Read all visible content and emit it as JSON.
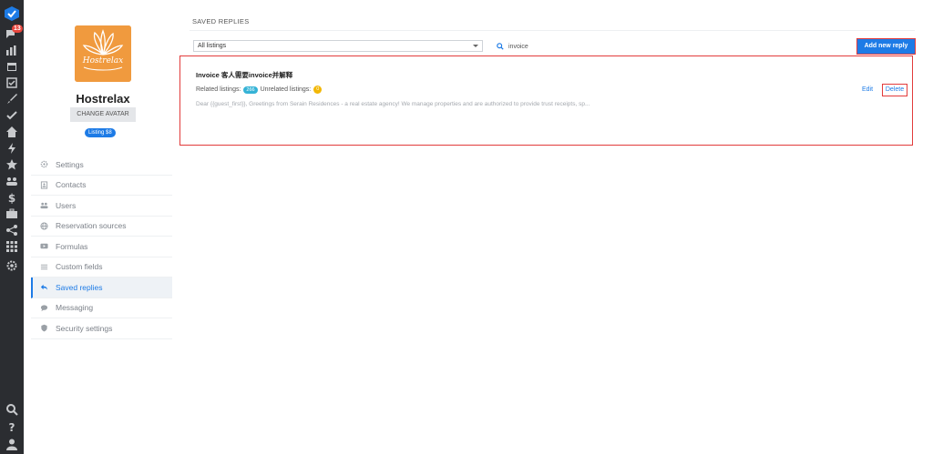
{
  "rail": {
    "notification_count": "13",
    "icons": [
      "check-logo-icon",
      "messages-icon",
      "analytics-icon",
      "calendar-icon",
      "tasks-icon",
      "brush-icon",
      "check-icon",
      "home-icon",
      "bolt-icon",
      "star-icon",
      "team-icon",
      "dollar-icon",
      "briefcase-icon",
      "share-icon",
      "apps-icon",
      "gear-icon"
    ],
    "bottom_icons": [
      "search-icon",
      "help-icon",
      "user-icon"
    ]
  },
  "profile": {
    "logo_text": "Hostrelax",
    "name": "Hostrelax",
    "change_avatar_label": "CHANGE AVATAR",
    "listing_label": "Listing $8"
  },
  "menu": {
    "items": [
      {
        "label": "Settings",
        "icon": "gear-icon",
        "active": false
      },
      {
        "label": "Contacts",
        "icon": "contacts-icon",
        "active": false
      },
      {
        "label": "Users",
        "icon": "users-icon",
        "active": false
      },
      {
        "label": "Reservation sources",
        "icon": "globe-icon",
        "active": false
      },
      {
        "label": "Formulas",
        "icon": "formula-icon",
        "active": false
      },
      {
        "label": "Custom fields",
        "icon": "list-icon",
        "active": false
      },
      {
        "label": "Saved replies",
        "icon": "reply-icon",
        "active": true
      },
      {
        "label": "Messaging",
        "icon": "chat-icon",
        "active": false
      },
      {
        "label": "Security settings",
        "icon": "shield-icon",
        "active": false
      }
    ]
  },
  "main": {
    "section_title": "SAVED REPLIES",
    "listings_select": "All listings",
    "search_value": "invoice",
    "add_button": "Add new reply",
    "reply": {
      "title": "Invoice 客人需要invoice并解释",
      "related_label": "Related listings:",
      "related_count": "266",
      "unrelated_label": "Unrelated listings:",
      "unrelated_count": "0",
      "preview": "Dear {{guest_first}}, Greetings from Serain Residences - a real estate agency! We manage properties and are authorized to provide trust receipts, sp...",
      "edit_label": "Edit",
      "delete_label": "Delete"
    }
  },
  "colors": {
    "accent": "#1d7be6",
    "highlight": "#e23b3b",
    "rail": "#2b2d31",
    "logo_bg": "#f09a3e"
  }
}
